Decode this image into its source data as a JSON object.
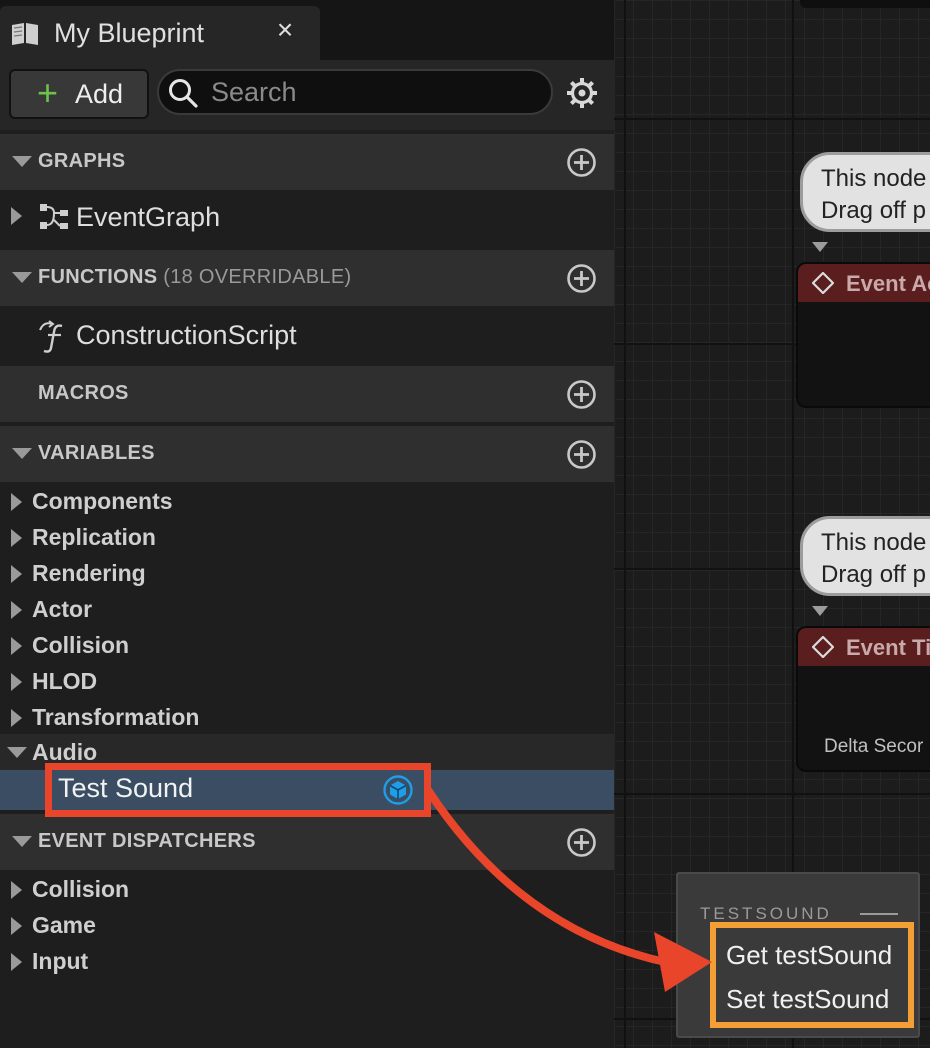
{
  "tab": {
    "title": "My Blueprint",
    "close": "×"
  },
  "toolbar": {
    "add_label": "Add",
    "search_placeholder": "Search"
  },
  "sections": {
    "graphs": {
      "label": "GRAPHS"
    },
    "functions": {
      "label": "FUNCTIONS",
      "sub": "(18 OVERRIDABLE)"
    },
    "macros": {
      "label": "MACROS"
    },
    "variables": {
      "label": "VARIABLES"
    },
    "event_dispatchers": {
      "label": "EVENT DISPATCHERS"
    }
  },
  "graphs": {
    "event_graph": "EventGraph"
  },
  "functions": {
    "construction_script": "ConstructionScript"
  },
  "variables": {
    "categories": [
      "Components",
      "Replication",
      "Rendering",
      "Actor",
      "Collision",
      "HLOD",
      "Transformation"
    ],
    "audio": {
      "label": "Audio",
      "item": "Test Sound"
    }
  },
  "event_dispatchers": {
    "items": [
      "Collision",
      "Game",
      "Input"
    ]
  },
  "graph": {
    "comment_1": {
      "line1": "This node",
      "line2": "Drag off p"
    },
    "node_1": {
      "title": "Event Ac"
    },
    "comment_2": {
      "line1": "This node",
      "line2": "Drag off p"
    },
    "node_2": {
      "title": "Event Ti",
      "pin": "Delta Secor"
    }
  },
  "drop_menu": {
    "header": "TESTSOUND",
    "get": "Get testSound",
    "set": "Set testSound"
  },
  "colors": {
    "highlight_red": "#e8452b",
    "highlight_orange": "#f39f36",
    "selection": "#3b4d63",
    "add_plus": "#6cc24a"
  },
  "icons": [
    "book-icon",
    "close-icon",
    "add-plus-icon",
    "search-icon",
    "gear-icon",
    "add-circle-icon",
    "graph-icon",
    "function-icon",
    "variable-type-icon",
    "event-diamond-icon"
  ]
}
